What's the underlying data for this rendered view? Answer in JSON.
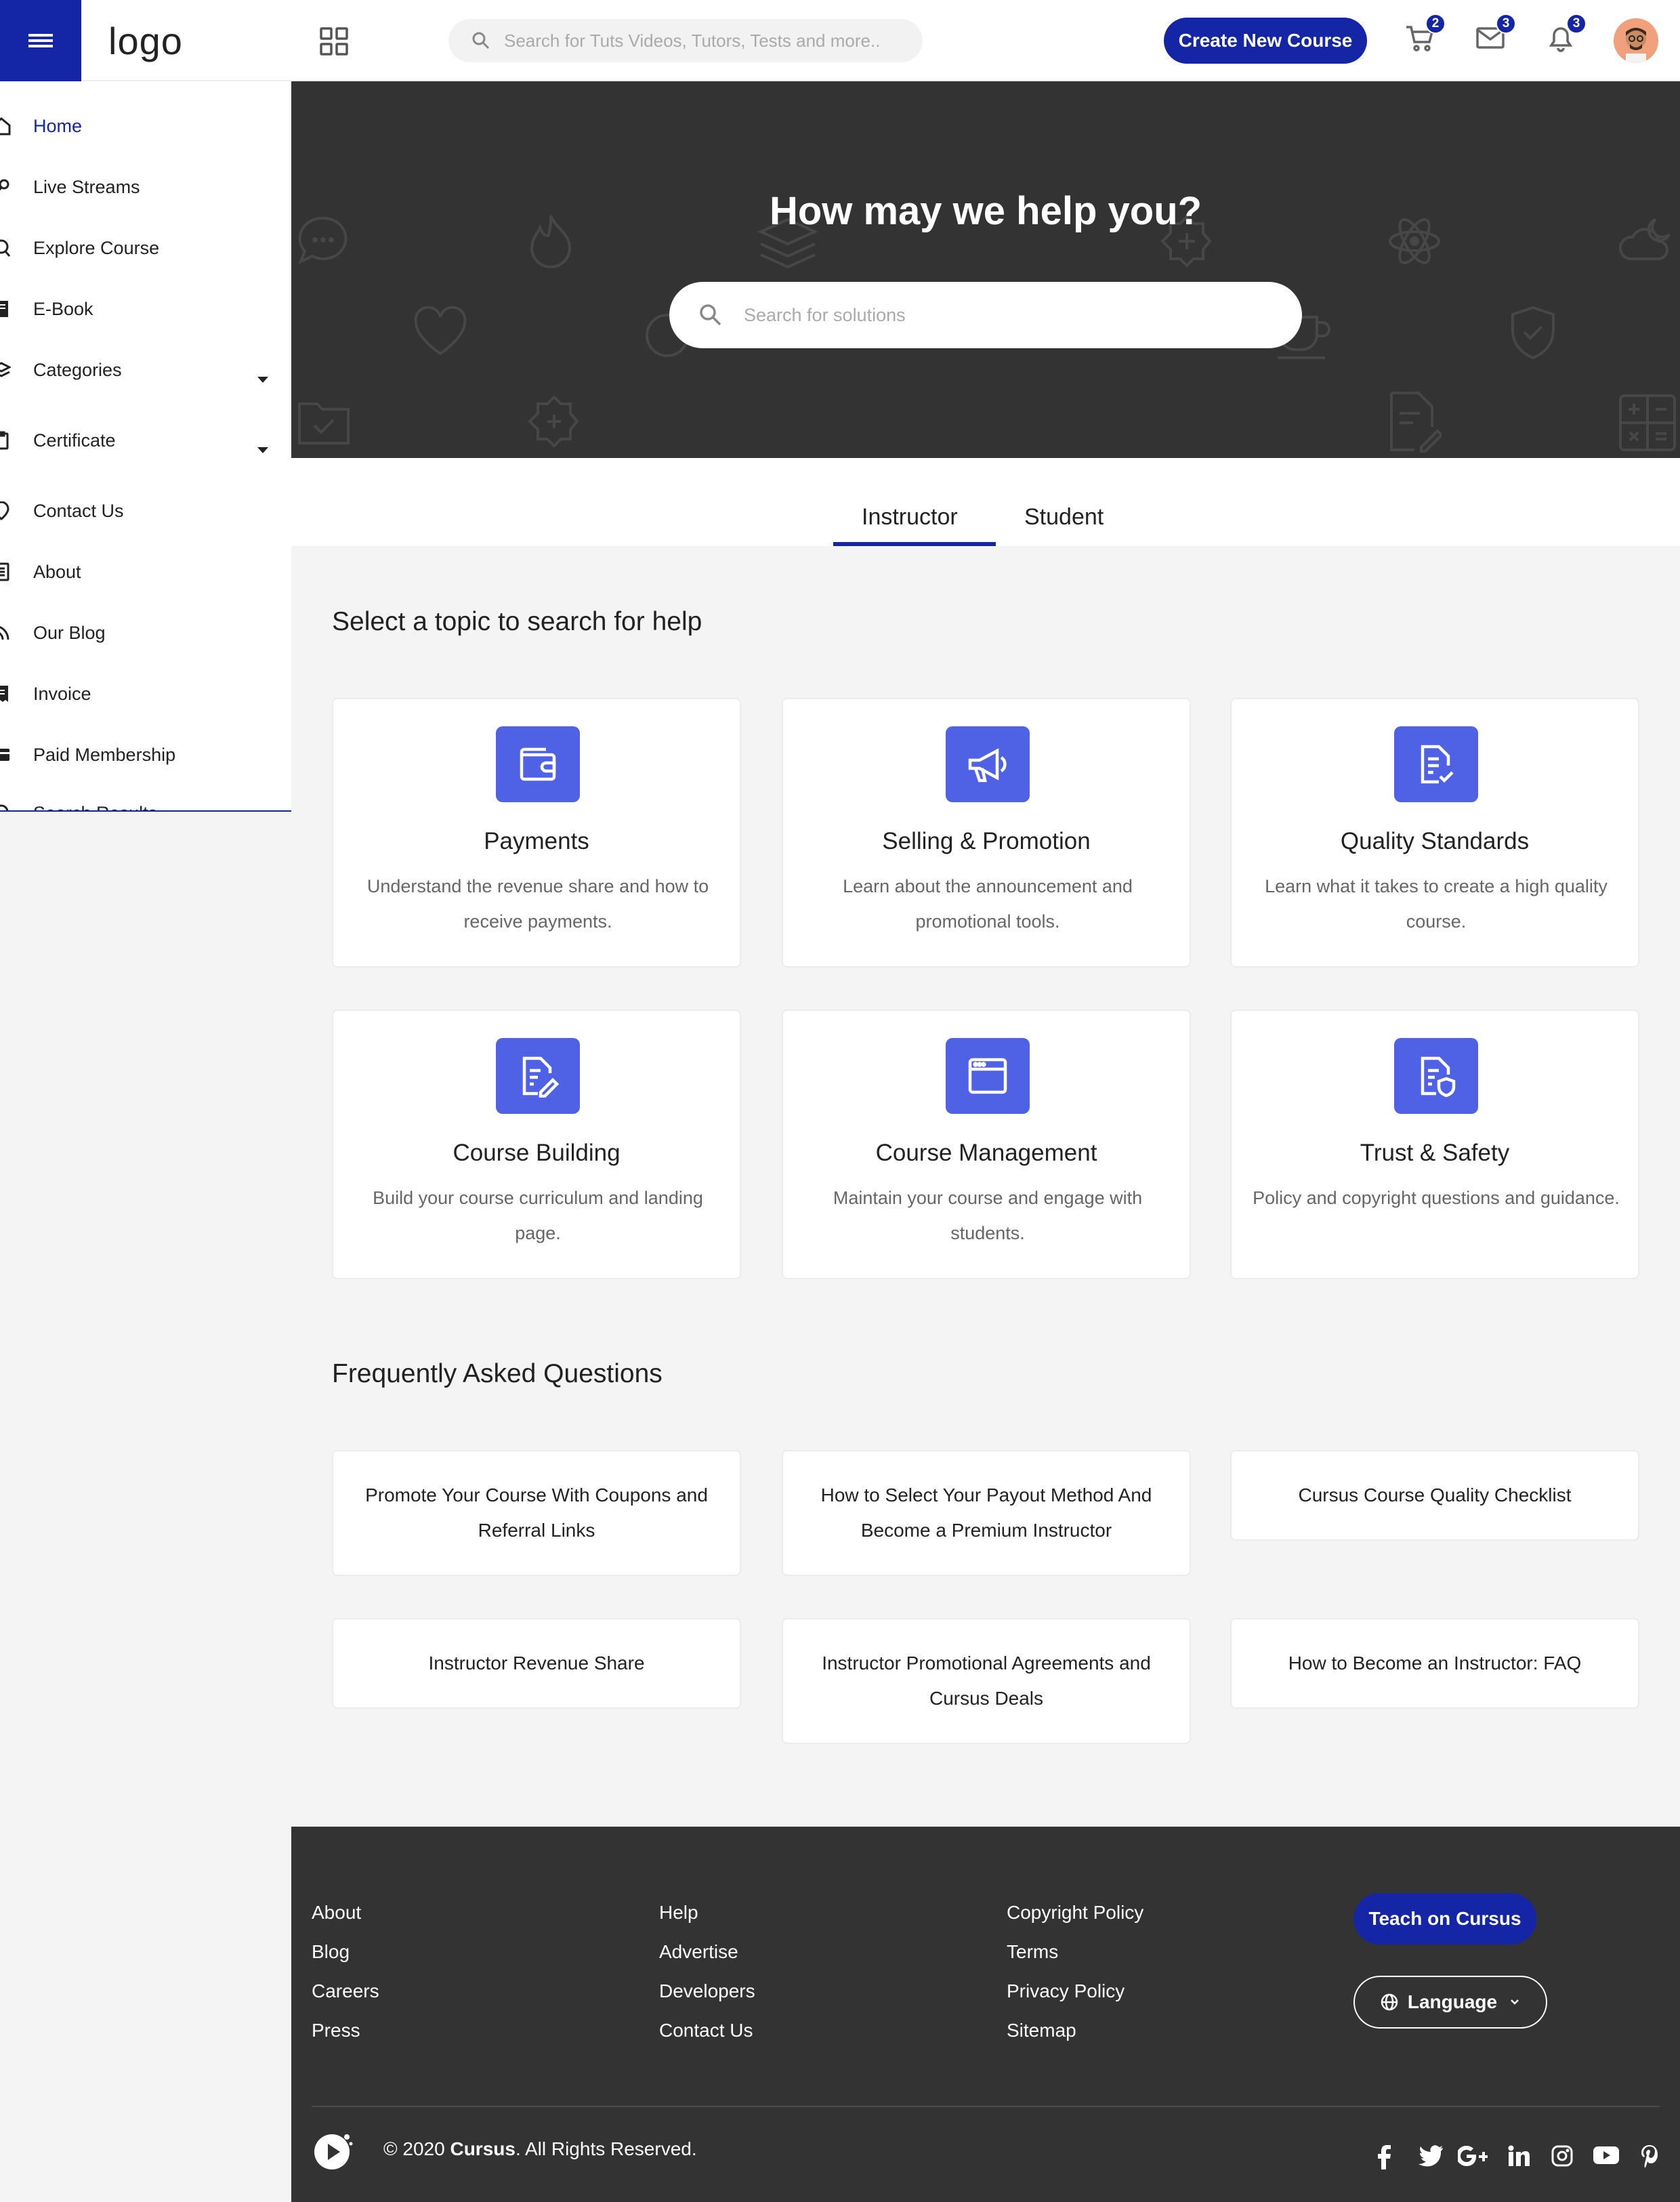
{
  "header": {
    "logo": "logo",
    "search_placeholder": "Search for Tuts Videos, Tutors, Tests and more..",
    "create_button": "Create New Course",
    "cart_count": "2",
    "messages_count": "3",
    "notifications_count": "3"
  },
  "sidebar": {
    "items": [
      {
        "label": "Home",
        "icon": "home-icon"
      },
      {
        "label": "Live Streams",
        "icon": "live-icon"
      },
      {
        "label": "Explore Course",
        "icon": "search-icon"
      },
      {
        "label": "E-Book",
        "icon": "book-icon"
      },
      {
        "label": "Categories",
        "icon": "layers-icon"
      },
      {
        "label": "Certificate",
        "icon": "certificate-icon"
      },
      {
        "label": "Contact Us",
        "icon": "contact-icon"
      },
      {
        "label": "About",
        "icon": "about-icon"
      },
      {
        "label": "Our Blog",
        "icon": "rss-icon"
      },
      {
        "label": "Invoice",
        "icon": "invoice-icon"
      },
      {
        "label": "Paid Membership",
        "icon": "card-icon"
      },
      {
        "label": "Search Results",
        "icon": "search-icon"
      }
    ]
  },
  "hero": {
    "title": "How may we help you?",
    "search_placeholder": "Search for solutions"
  },
  "tabs": [
    "Instructor",
    "Student"
  ],
  "topics": {
    "title": "Select a topic to search for help",
    "cards": [
      {
        "title": "Payments",
        "desc": "Understand the revenue share and how to receive payments.",
        "icon": "wallet-icon"
      },
      {
        "title": "Selling & Promotion",
        "desc": "Learn about the announcement and promotional tools.",
        "icon": "megaphone-icon"
      },
      {
        "title": "Quality Standards",
        "desc": "Learn what it takes to create a high quality course.",
        "icon": "document-check-icon"
      },
      {
        "title": "Course Building",
        "desc": "Build your course curriculum and landing page.",
        "icon": "document-edit-icon"
      },
      {
        "title": "Course Management",
        "desc": "Maintain your course and engage with students.",
        "icon": "window-icon"
      },
      {
        "title": "Trust & Safety",
        "desc": "Policy and copyright questions and guidance.",
        "icon": "document-shield-icon"
      }
    ]
  },
  "faq": {
    "title": "Frequently Asked Questions",
    "items": [
      "Promote Your Course With Coupons and Referral Links",
      "How to Select Your Payout Method And Become a Premium Instructor",
      "Cursus Course Quality Checklist",
      "Instructor Revenue Share",
      "Instructor Promotional Agreements and Cursus Deals",
      "How to Become an Instructor: FAQ"
    ]
  },
  "footer": {
    "col1": [
      "About",
      "Blog",
      "Careers",
      "Press"
    ],
    "col2": [
      "Help",
      "Advertise",
      "Developers",
      "Contact Us"
    ],
    "col3": [
      "Copyright Policy",
      "Terms",
      "Privacy Policy",
      "Sitemap"
    ],
    "teach_button": "Teach on Cursus",
    "language_button": "Language",
    "copyright_prefix": "© 2020",
    "brand": "Cursus",
    "copyright_suffix": ". All Rights Reserved.",
    "social": [
      "facebook-icon",
      "twitter-icon",
      "google-plus-icon",
      "linkedin-icon",
      "instagram-icon",
      "youtube-icon",
      "pinterest-icon"
    ]
  },
  "colors": {
    "primary": "#1426a6",
    "accent": "#4f62e6",
    "dark": "#333333"
  }
}
